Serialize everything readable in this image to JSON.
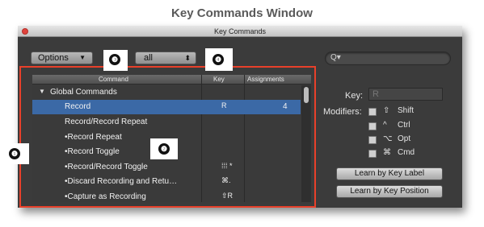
{
  "doc_title": "Key Commands Window",
  "window": {
    "title": "Key Commands"
  },
  "toolbar": {
    "options_label": "Options",
    "options_arrow": "▼",
    "filter_colon": ":",
    "filter_value": "all",
    "filter_arrow": "⬍"
  },
  "search": {
    "icon": "Q▾"
  },
  "list": {
    "columns": {
      "command": "Command",
      "key": "Key",
      "assignments": "Assignments"
    },
    "rows": [
      {
        "command": "Global Commands",
        "key": "",
        "assignments": "",
        "section": true,
        "disclosure": "▼"
      },
      {
        "command": "Record",
        "key": "R",
        "assignments": "4",
        "selected": true
      },
      {
        "command": "Record/Record Repeat",
        "key": "",
        "assignments": ""
      },
      {
        "command": "•Record Repeat",
        "key": "",
        "assignments": ""
      },
      {
        "command": "•Record Toggle",
        "key": "",
        "assignments": ""
      },
      {
        "command": "•Record/Record Toggle",
        "key": "⁞⁞⁞ *",
        "assignments": ""
      },
      {
        "command": "•Discard Recording and Retu…",
        "key": "⌘.",
        "assignments": ""
      },
      {
        "command": "•Capture as Recording",
        "key": "⇧R",
        "assignments": ""
      }
    ]
  },
  "key_panel": {
    "key_label": "Key:",
    "key_value": "R",
    "modifiers_label": "Modifiers:"
  },
  "modifiers": [
    {
      "symbol": "⇧",
      "name": "Shift"
    },
    {
      "symbol": "^",
      "name": "Ctrl"
    },
    {
      "symbol": "⌥",
      "name": "Opt"
    },
    {
      "symbol": "⌘",
      "name": "Cmd"
    }
  ],
  "buttons": {
    "learn_label": "Learn by Key Label",
    "learn_position": "Learn by Key Position"
  },
  "callouts": [
    "❶",
    "❷",
    "❸",
    "❹"
  ],
  "colors": {
    "selection": "#3b69a6",
    "highlight_frame": "#e8402a",
    "window_bg": "#3b3b3b"
  }
}
